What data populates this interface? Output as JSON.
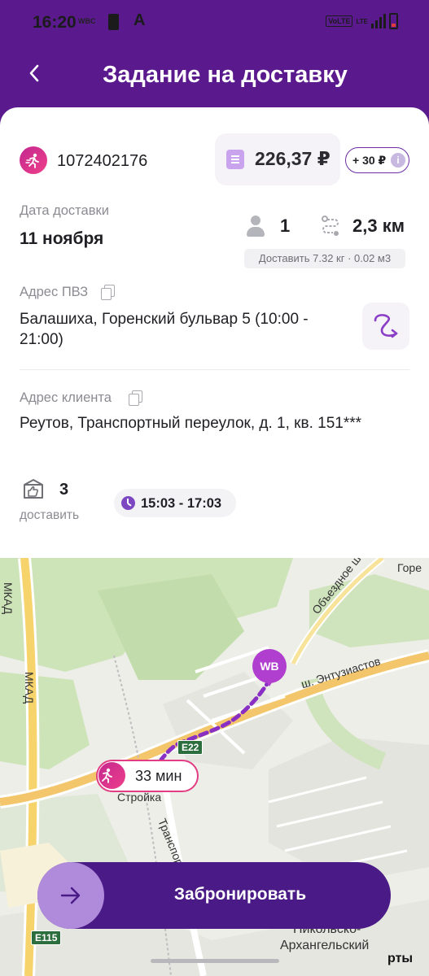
{
  "status_bar": {
    "time": "16:20",
    "carrier": "WBC",
    "a_icon": "A",
    "volte": "VoLTE",
    "lte": "LTE"
  },
  "header": {
    "title": "Задание на доставку",
    "back_icon": "chevron-left-icon"
  },
  "order": {
    "id": "1072402176",
    "price": "226,37 ₽",
    "bonus": "+ 30 ₽",
    "info_icon_label": "i"
  },
  "delivery": {
    "date_label": "Дата доставки",
    "date_value": "11 ноября",
    "persons": "1",
    "distance": "2,3 км",
    "weight_note": "Доставить 7.32 кг · 0.02 м3"
  },
  "pvz": {
    "label": "Адрес ПВЗ",
    "address": "Балашиха, Горенский бульвар 5 (10:00 - 21:00)"
  },
  "client": {
    "label": "Адрес клиента",
    "address": "Реутов, Транспортный переулок, д. 1, кв. 151***"
  },
  "summary": {
    "deliver_count": "3",
    "deliver_label": "доставить",
    "time_window": "15:03 - 17:03"
  },
  "map": {
    "labels": {
      "mkad_top": "МКАД",
      "mkad_side": "МКАД",
      "obezdnoe": "Объездное ш.",
      "gore": "Горе",
      "entuziastov": "ш. Энтузиастов",
      "stroika": "Стройка",
      "transportnaya": "Транспортная",
      "nikolsko": "Никольско-",
      "arkhangelsky": "Архангельский",
      "rty": "рты"
    },
    "shields": {
      "e22": "E22",
      "e115": "E115"
    },
    "pin_label": "WB",
    "eta": "33 мин"
  },
  "actions": {
    "book_label": "Забронировать"
  }
}
